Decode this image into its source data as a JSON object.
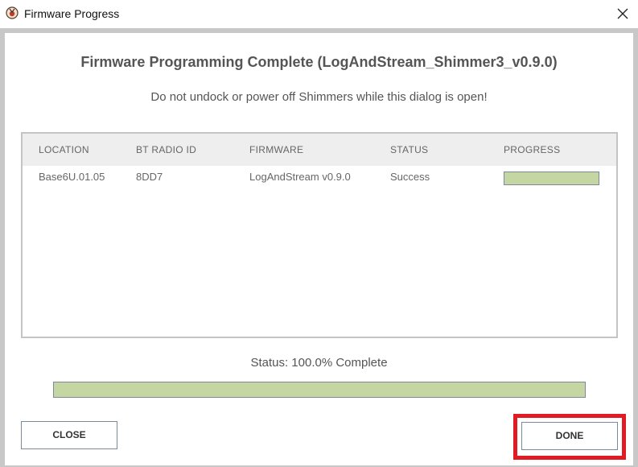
{
  "window": {
    "title": "Firmware Progress",
    "icon": "shimmer-app-icon",
    "close_icon": "close-x-icon"
  },
  "dialog": {
    "heading": "Firmware Programming Complete (LogAndStream_Shimmer3_v0.9.0)",
    "warning": "Do not undock or power off Shimmers while this dialog is open!"
  },
  "table": {
    "columns": [
      "LOCATION",
      "BT RADIO ID",
      "FIRMWARE",
      "STATUS",
      "PROGRESS"
    ],
    "rows": [
      {
        "location": "Base6U.01.05",
        "bt_radio_id": "8DD7",
        "firmware": "LogAndStream v0.9.0",
        "status": "Success",
        "progress": 1.0
      }
    ]
  },
  "status": {
    "text": "Status: 100.0% Complete",
    "progress": 1.0
  },
  "buttons": {
    "close_label": "CLOSE",
    "done_label": "DONE"
  },
  "colors": {
    "progress_fill": "#c5d6a2",
    "highlight": "#e01b24",
    "frame": "#c8c8c8"
  }
}
